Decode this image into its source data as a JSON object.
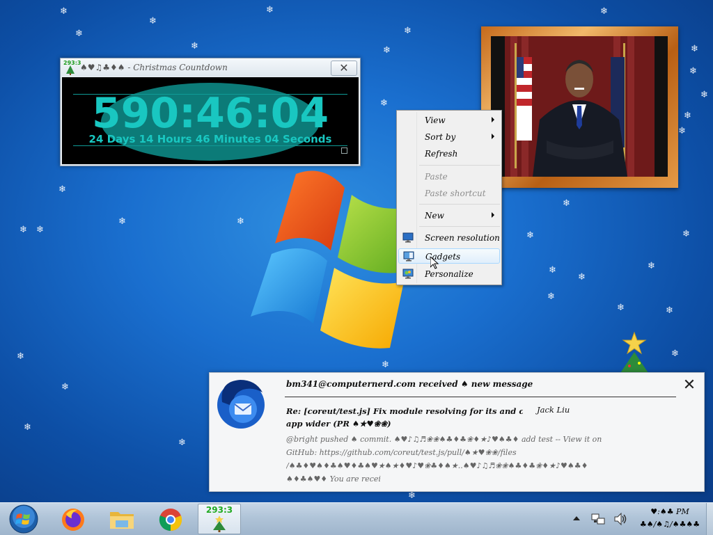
{
  "countdown": {
    "counter_label": "293:3",
    "title": "♠♥♫♣♦♠ - Christmas Countdown",
    "close_label": "✕",
    "time": "590:46:04",
    "detail": "24 Days 14 Hours 46 Minutes 04 Seconds"
  },
  "context_menu": {
    "items": [
      {
        "label": "View",
        "submenu": true,
        "disabled": false
      },
      {
        "label": "Sort by",
        "submenu": true,
        "disabled": false
      },
      {
        "label": "Refresh",
        "submenu": false,
        "disabled": false
      },
      {
        "label": "Paste",
        "submenu": false,
        "disabled": true
      },
      {
        "label": "Paste shortcut",
        "submenu": false,
        "disabled": true
      },
      {
        "label": "New",
        "submenu": true,
        "disabled": false
      },
      {
        "label": "Screen resolution",
        "submenu": false,
        "disabled": false
      },
      {
        "label": "Gadgets",
        "submenu": false,
        "disabled": false,
        "highlighted": true
      },
      {
        "label": "Personalize",
        "submenu": false,
        "disabled": false
      }
    ]
  },
  "notification": {
    "header": "bm341@computernerd.com received ♠ new message",
    "close_label": "✕",
    "subject_line1": "Re: [coreut/test.js] Fix module resolving for its and chart layer compilation in",
    "subject_line2": "app wider (PR ♠★♥❀❀)",
    "author": "Jack Liu",
    "body_line1": "@bright pushed ♠ commit. ♠♥♪♫♬❀❀♠♣♦♣❀♦★♪♥♠♣♦ add test -- View it on",
    "body_line2": "GitHub: https://github.com/coreut/test.js/pull/♠★♥❀❀/files",
    "body_line3": "/♠♣♦♥♠♦♣♠♥♦♣♠♥★♠★♦♥♪♥❀♣♦♠★..♠♥♪♫♬❀❀♠♣♦♣❀♦★♪♥♠♣♦",
    "body_line4": "♠♦♣♠♥♦ You are recei"
  },
  "taskbar": {
    "items": [
      "firefox",
      "file-explorer",
      "chrome",
      "christmas-countdown"
    ],
    "active_label": "293:3",
    "time": "♥:♠♣ PM",
    "date": "♣♠/♠♫/♠♣♠♣"
  },
  "colors": {
    "countdown_text": "#19c7c1",
    "countdown_ellipse": "#0c7b78",
    "desktop_blue": "#1a6fcf"
  }
}
